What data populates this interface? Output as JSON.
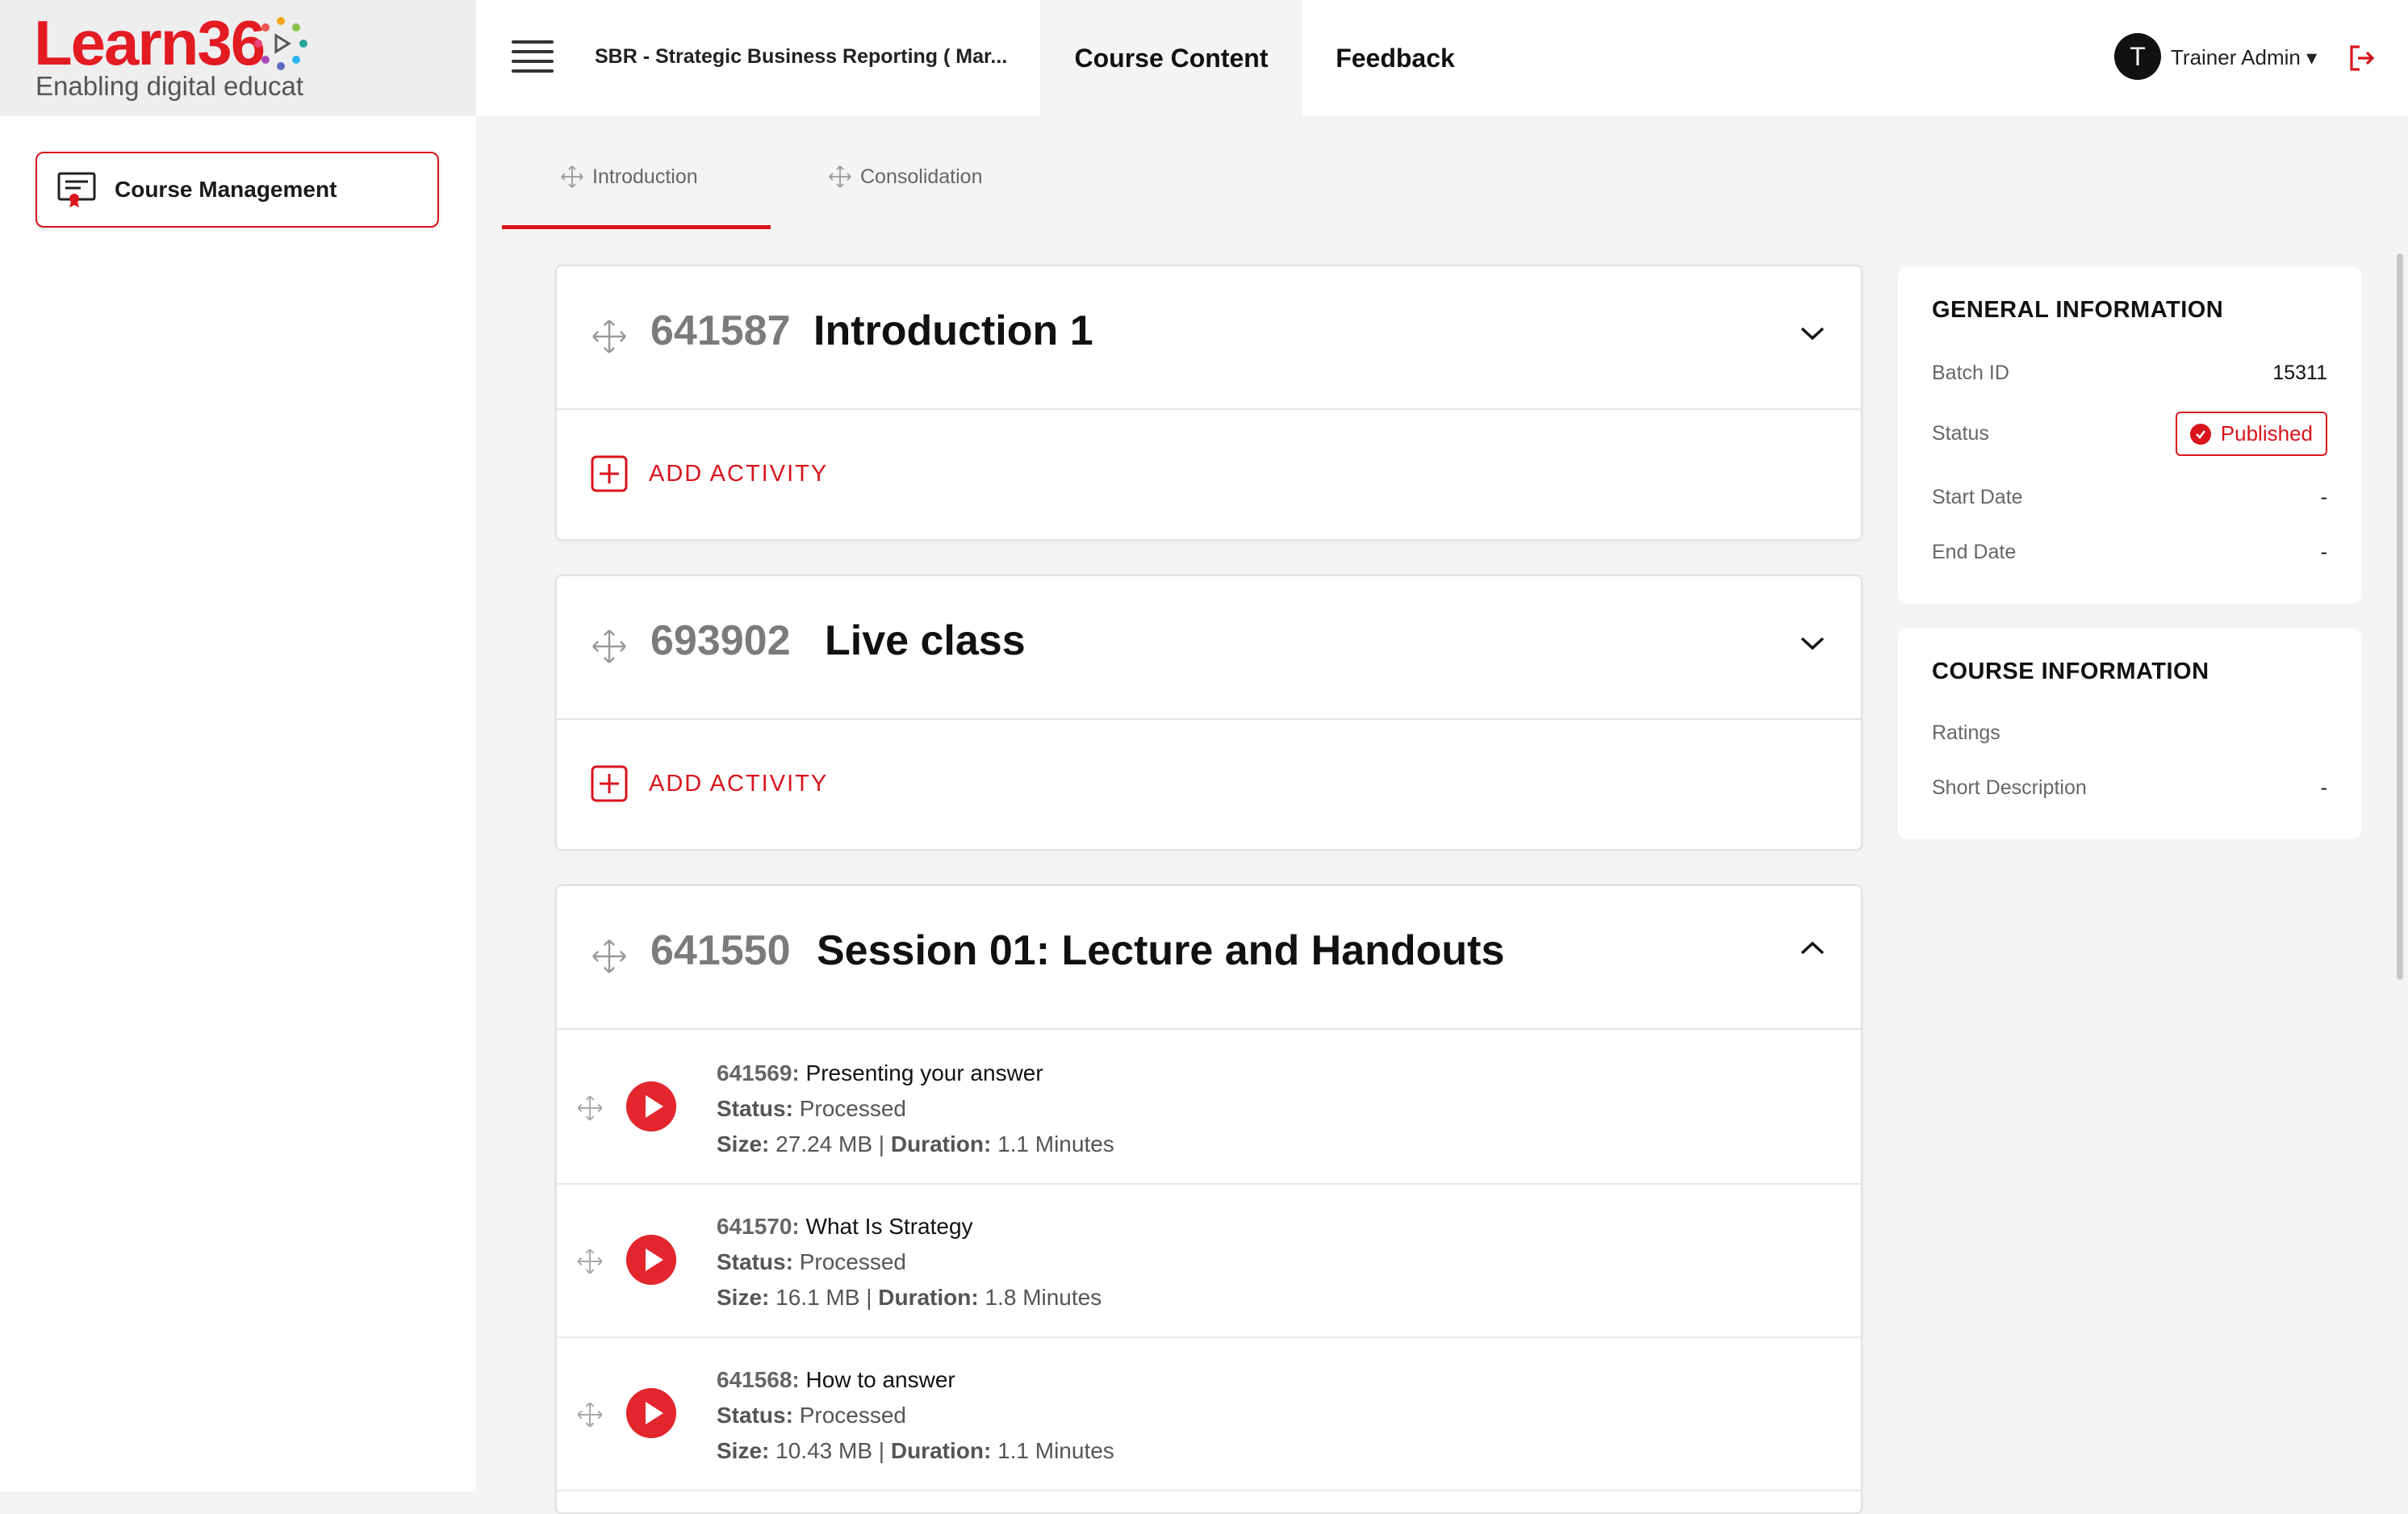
{
  "logo": {
    "wordmark_a": "Learn36",
    "wordmark_b": "",
    "tagline": "Enabling digital educat"
  },
  "sidebar": {
    "items": [
      {
        "label": "Course Management",
        "icon": "certificate-icon"
      }
    ]
  },
  "header": {
    "course_name": "SBR - Strategic Business Reporting ( Mar...",
    "tabs": [
      {
        "label": "Course Content",
        "active": true
      },
      {
        "label": "Feedback",
        "active": false
      }
    ],
    "user": {
      "initial": "T",
      "name": "Trainer Admin ▾"
    }
  },
  "subtabs": [
    {
      "label": "Introduction",
      "active": true
    },
    {
      "label": "Consolidation",
      "active": false
    }
  ],
  "sections": [
    {
      "id": "641587",
      "title": "Introduction 1",
      "expanded": false,
      "add_label": "ADD ACTIVITY"
    },
    {
      "id": "693902",
      "title": "Live class",
      "expanded": false,
      "add_label": "ADD ACTIVITY"
    },
    {
      "id": "641550",
      "title": "Session 01: Lecture and Handouts",
      "expanded": true,
      "items": [
        {
          "id": "641569:",
          "name": "Presenting your answer",
          "status_label": "Status:",
          "status": "Processed",
          "size_label": "Size:",
          "size": "27.24 MB",
          "sep": "|",
          "duration_label": "Duration:",
          "duration": "1.1 Minutes"
        },
        {
          "id": "641570:",
          "name": "What Is Strategy",
          "status_label": "Status:",
          "status": "Processed",
          "size_label": "Size:",
          "size": "16.1 MB",
          "sep": "|",
          "duration_label": "Duration:",
          "duration": "1.8 Minutes"
        },
        {
          "id": "641568:",
          "name": "How to answer",
          "status_label": "Status:",
          "status": "Processed",
          "size_label": "Size:",
          "size": "10.43 MB",
          "sep": "|",
          "duration_label": "Duration:",
          "duration": "1.1 Minutes"
        }
      ]
    }
  ],
  "general_info": {
    "heading": "GENERAL INFORMATION",
    "rows": [
      {
        "label": "Batch ID",
        "value": "15311"
      },
      {
        "label": "Status",
        "value": "Published"
      },
      {
        "label": "Start Date",
        "value": "-"
      },
      {
        "label": "End Date",
        "value": "-"
      }
    ]
  },
  "course_info": {
    "heading": "COURSE INFORMATION",
    "rows": [
      {
        "label": "Ratings",
        "value": ""
      },
      {
        "label": "Short Description",
        "value": "-"
      }
    ]
  },
  "colors": {
    "accent": "#d8141c",
    "play": "#e3262d",
    "page_bg": "#f4f4f4"
  }
}
